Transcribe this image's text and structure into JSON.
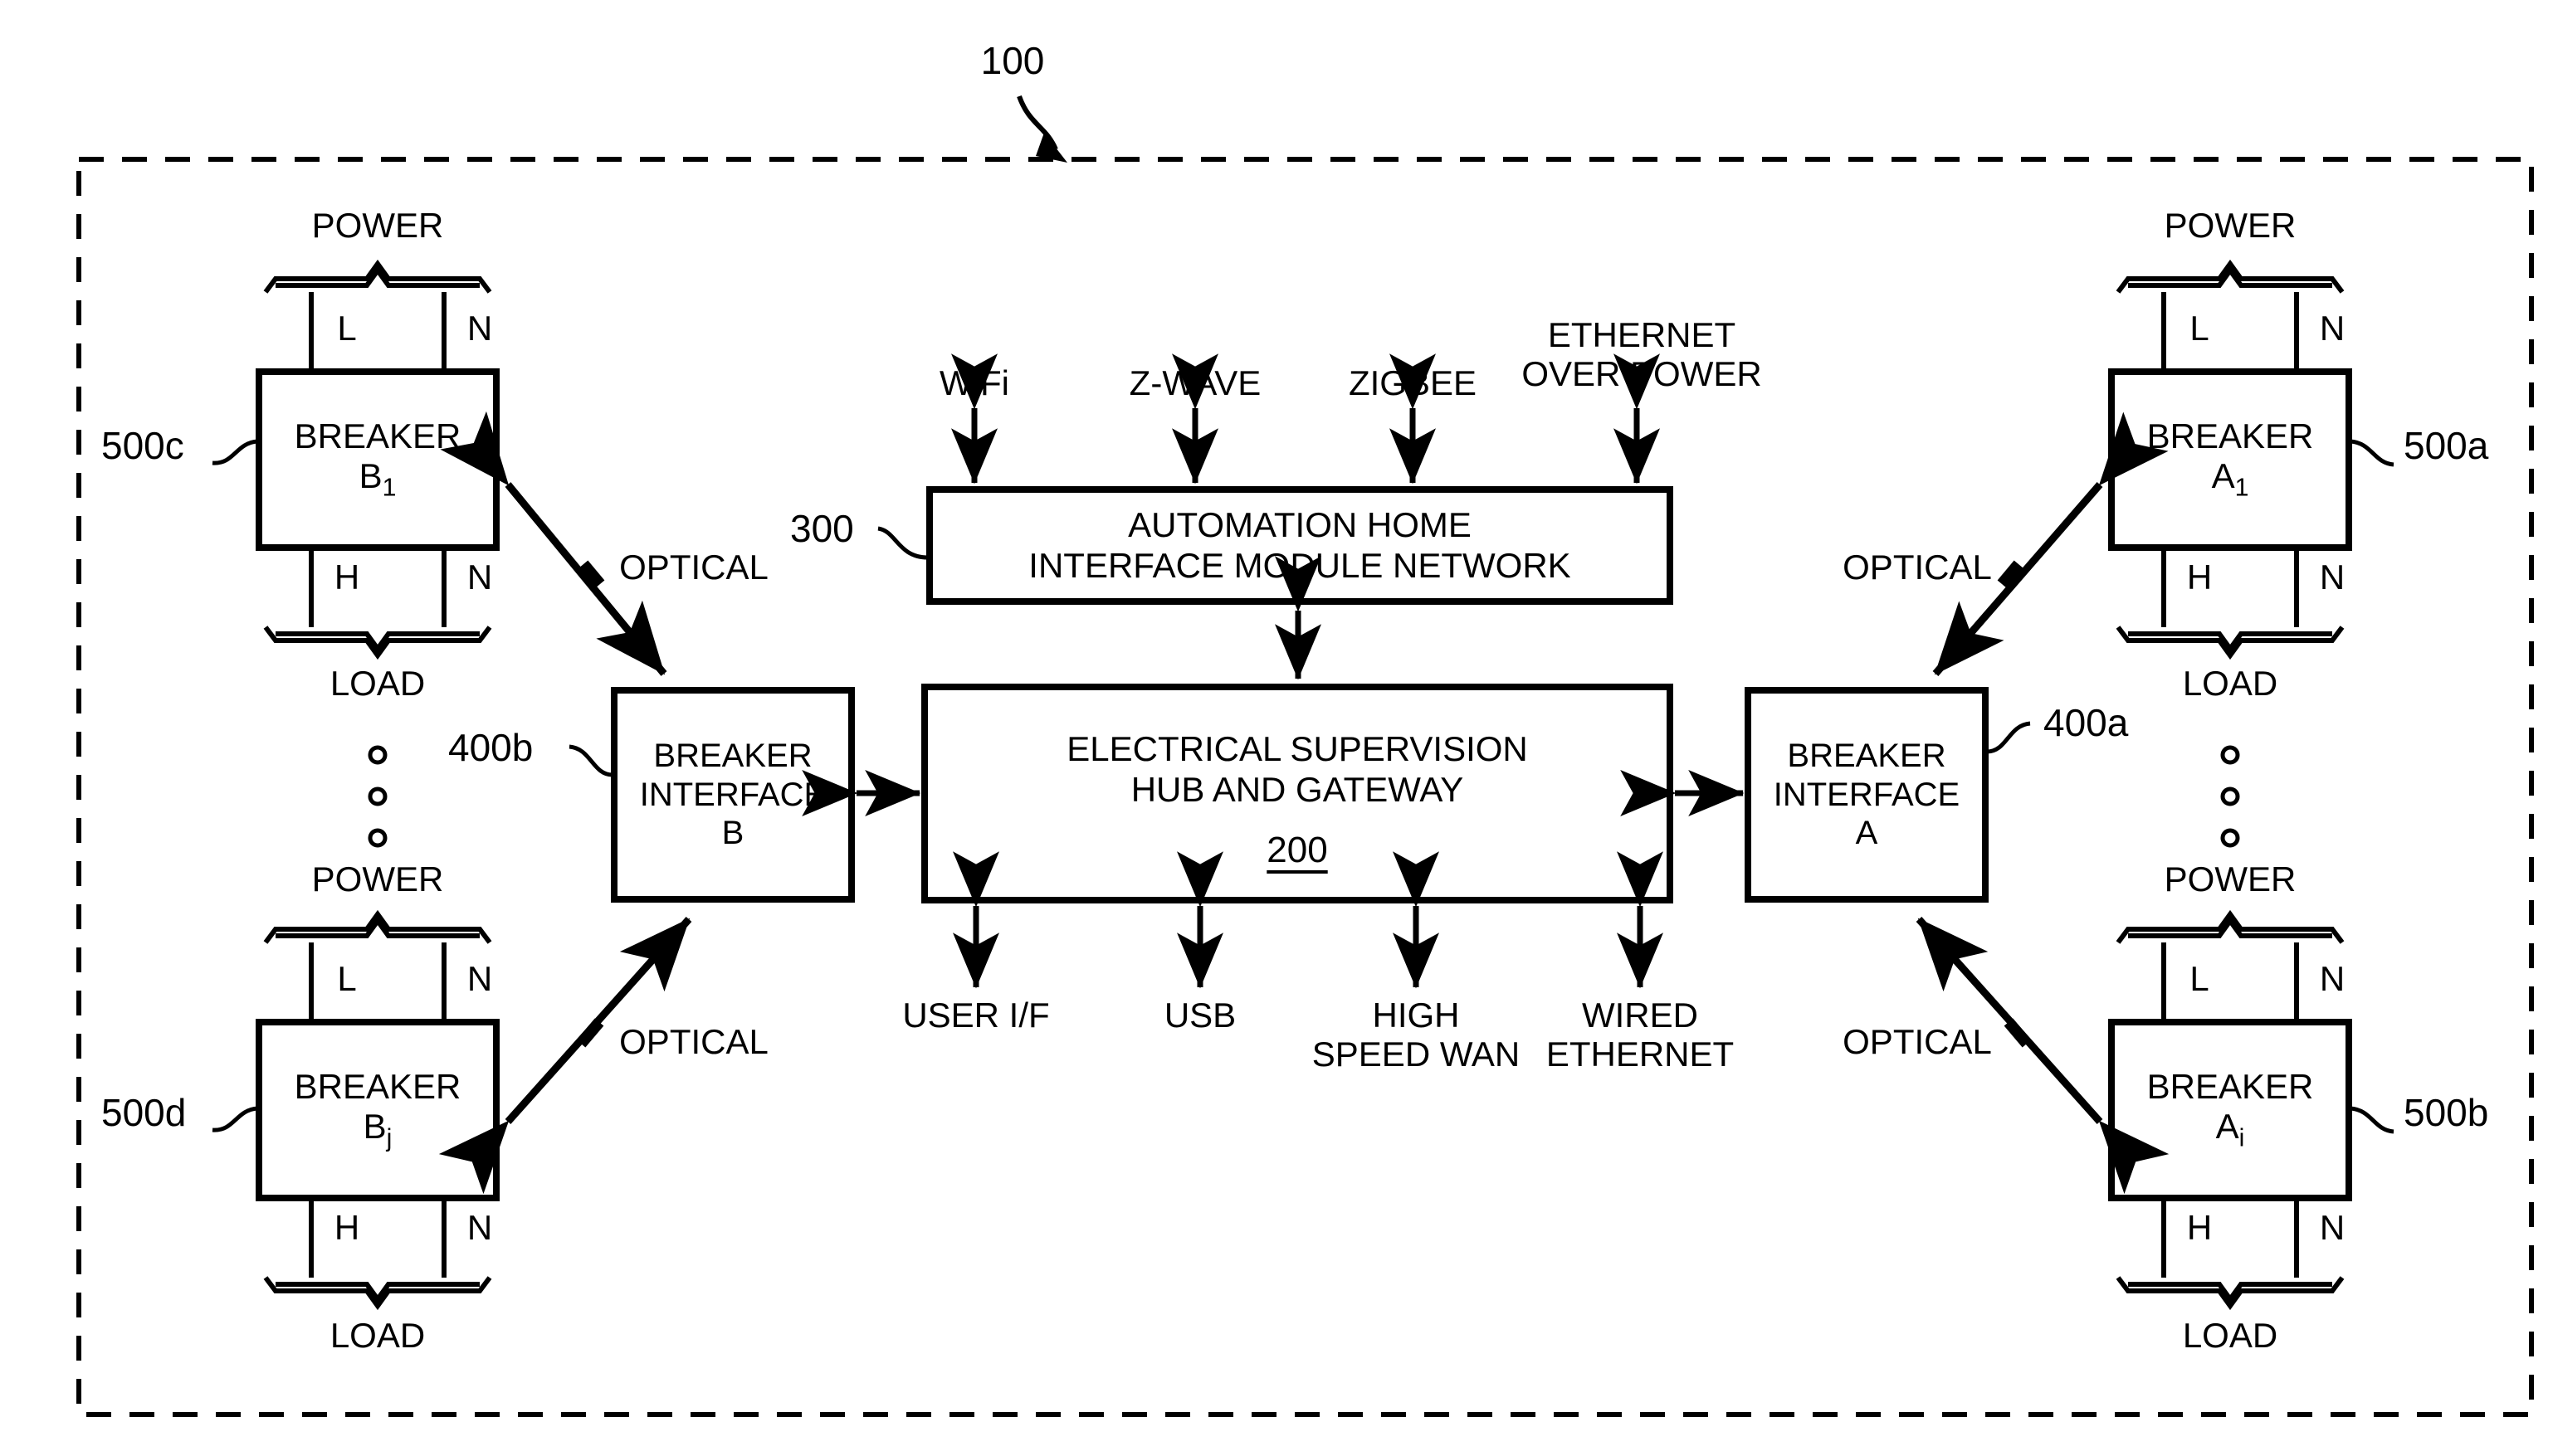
{
  "figure": {
    "system_ref": "100",
    "outer_boundary": "dashed system boundary"
  },
  "hub": {
    "line1": "ELECTRICAL SUPERVISION",
    "line2": "HUB AND GATEWAY",
    "ref": "200"
  },
  "automation_network": {
    "line1": "AUTOMATION HOME",
    "line2": "INTERFACE MODULE NETWORK",
    "ref": "300"
  },
  "top_interfaces": [
    {
      "label": "WiFi"
    },
    {
      "label": "Z-WAVE"
    },
    {
      "label": "ZIGBEE"
    },
    {
      "label": "ETHERNET\nOVER POWER"
    }
  ],
  "bottom_interfaces": [
    {
      "label": "USER I/F"
    },
    {
      "label": "USB"
    },
    {
      "label": "HIGH\nSPEED WAN"
    },
    {
      "label": "WIRED\nETHERNET"
    }
  ],
  "breaker_interfaces": [
    {
      "ref": "400b",
      "line1": "BREAKER",
      "line2": "INTERFACE",
      "line3": "B"
    },
    {
      "ref": "400a",
      "line1": "BREAKER",
      "line2": "INTERFACE",
      "line3": "A"
    }
  ],
  "breakers": [
    {
      "ref": "500c",
      "name": "BREAKER",
      "id": "B",
      "index": "1",
      "power_label": "POWER",
      "load_label": "LOAD",
      "top_terminals": [
        "L",
        "N"
      ],
      "bottom_terminals": [
        "H",
        "N"
      ]
    },
    {
      "ref": "500d",
      "name": "BREAKER",
      "id": "B",
      "index": "j",
      "power_label": "POWER",
      "load_label": "LOAD",
      "top_terminals": [
        "L",
        "N"
      ],
      "bottom_terminals": [
        "H",
        "N"
      ]
    },
    {
      "ref": "500a",
      "name": "BREAKER",
      "id": "A",
      "index": "1",
      "power_label": "POWER",
      "load_label": "LOAD",
      "top_terminals": [
        "L",
        "N"
      ],
      "bottom_terminals": [
        "H",
        "N"
      ]
    },
    {
      "ref": "500b",
      "name": "BREAKER",
      "id": "A",
      "index": "i",
      "power_label": "POWER",
      "load_label": "LOAD",
      "top_terminals": [
        "L",
        "N"
      ],
      "bottom_terminals": [
        "H",
        "N"
      ]
    }
  ],
  "links": [
    {
      "label": "OPTICAL"
    },
    {
      "label": "OPTICAL"
    },
    {
      "label": "OPTICAL"
    },
    {
      "label": "OPTICAL"
    }
  ],
  "colors": {
    "ink": "#000000",
    "paper": "#ffffff"
  }
}
